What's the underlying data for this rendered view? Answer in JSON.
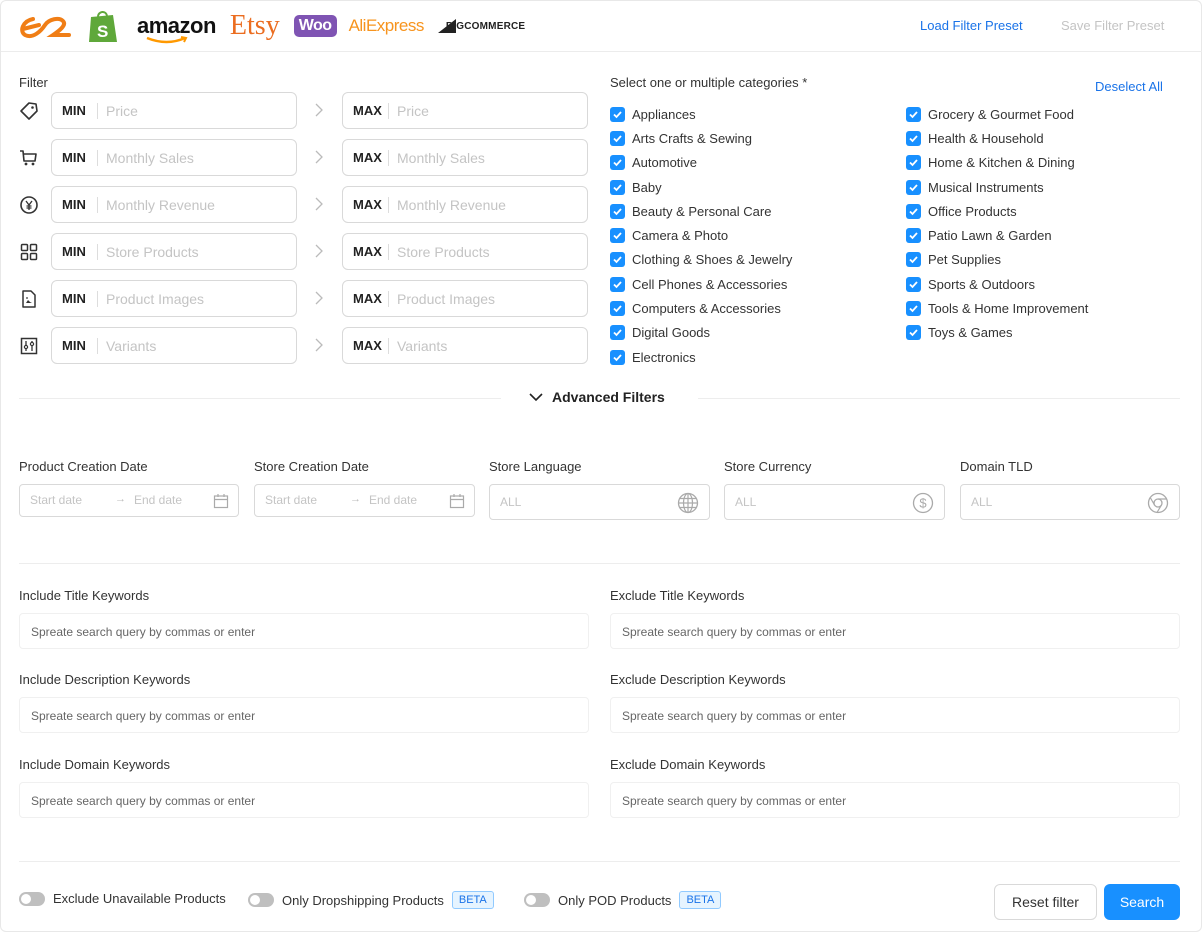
{
  "header": {
    "logos": [
      "Alibaba",
      "Shopify",
      "amazon",
      "Etsy",
      "Woo",
      "AliExpress",
      "BIGCOMMERCE"
    ],
    "load_preset": "Load Filter Preset",
    "save_preset": "Save Filter Preset"
  },
  "filter": {
    "label": "Filter",
    "min_tag": "MIN",
    "max_tag": "MAX",
    "rows": [
      {
        "icon": "price-tag-icon",
        "placeholder": "Price"
      },
      {
        "icon": "cart-icon",
        "placeholder": "Monthly Sales"
      },
      {
        "icon": "yen-circle-icon",
        "placeholder": "Monthly Revenue"
      },
      {
        "icon": "grid-icon",
        "placeholder": "Store Products"
      },
      {
        "icon": "image-file-icon",
        "placeholder": "Product Images"
      },
      {
        "icon": "sliders-icon",
        "placeholder": "Variants"
      }
    ]
  },
  "categories": {
    "title": "Select one or multiple categories *",
    "deselect_all": "Deselect All",
    "left": [
      {
        "label": "Appliances",
        "checked": true
      },
      {
        "label": "Arts Crafts & Sewing",
        "checked": true
      },
      {
        "label": "Automotive",
        "checked": true
      },
      {
        "label": "Baby",
        "checked": true
      },
      {
        "label": "Beauty & Personal Care",
        "checked": true
      },
      {
        "label": "Camera & Photo",
        "checked": true
      },
      {
        "label": "Clothing & Shoes & Jewelry",
        "checked": true
      },
      {
        "label": "Cell Phones & Accessories",
        "checked": true
      },
      {
        "label": "Computers & Accessories",
        "checked": true
      },
      {
        "label": "Digital Goods",
        "checked": true
      },
      {
        "label": "Electronics",
        "checked": true
      }
    ],
    "right": [
      {
        "label": "Grocery & Gourmet Food",
        "checked": true
      },
      {
        "label": "Health & Household",
        "checked": true
      },
      {
        "label": "Home & Kitchen & Dining",
        "checked": true
      },
      {
        "label": "Musical Instruments",
        "checked": true
      },
      {
        "label": "Office Products",
        "checked": true
      },
      {
        "label": "Patio Lawn & Garden",
        "checked": true
      },
      {
        "label": "Pet Supplies",
        "checked": true
      },
      {
        "label": "Sports & Outdoors",
        "checked": true
      },
      {
        "label": "Tools & Home Improvement",
        "checked": true
      },
      {
        "label": "Toys & Games",
        "checked": true
      }
    ]
  },
  "advanced": {
    "label": "Advanced Filters",
    "product_date": {
      "label": "Product Creation Date",
      "start": "Start date",
      "end": "End date"
    },
    "store_date": {
      "label": "Store Creation Date",
      "start": "Start date",
      "end": "End date"
    },
    "language": {
      "label": "Store Language",
      "value": "ALL"
    },
    "currency": {
      "label": "Store Currency",
      "value": "ALL"
    },
    "tld": {
      "label": "Domain TLD",
      "value": "ALL"
    }
  },
  "keywords": {
    "placeholder": "Spreate search query by commas or enter",
    "include_title": "Include Title Keywords",
    "exclude_title": "Exclude Title Keywords",
    "include_desc": "Include Description Keywords",
    "exclude_desc": "Exclude Description Keywords",
    "include_domain": "Include Domain Keywords",
    "exclude_domain": "Exclude Domain Keywords"
  },
  "footer": {
    "toggles": [
      {
        "label": "Exclude Unavailable Products",
        "on": false,
        "badge": ""
      },
      {
        "label": "Only Dropshipping Products",
        "on": false,
        "badge": "BETA"
      },
      {
        "label": "Only POD Products",
        "on": false,
        "badge": "BETA"
      }
    ],
    "reset": "Reset filter",
    "search": "Search"
  },
  "colors": {
    "accent": "#1890ff",
    "link": "#1a73e8",
    "disabled": "#c4c4c4"
  }
}
